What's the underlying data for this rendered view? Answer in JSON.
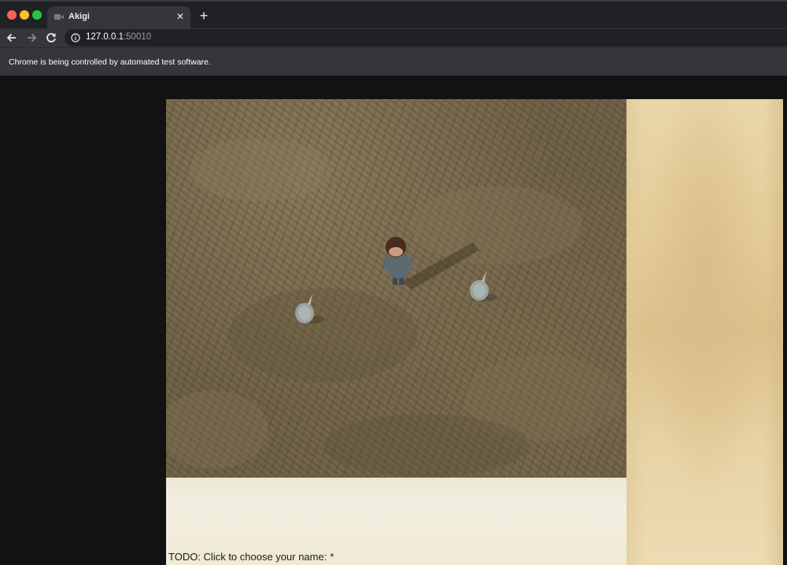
{
  "browser": {
    "tab": {
      "title": "Akigi",
      "favicon": "video-icon",
      "close_label": "✕"
    },
    "new_tab_label": "+",
    "url": {
      "host": "127.0.0.1",
      "port": ":50010"
    },
    "infobar": "Chrome is being controlled by automated test software."
  },
  "game": {
    "prompt_text": "TODO: Click to choose your name:",
    "cursor": "*"
  },
  "colors": {
    "ground": "#6f6248",
    "dialog_bg": "#efe9d6",
    "side_panel": "#e4cc98",
    "page_bg": "#121212"
  }
}
